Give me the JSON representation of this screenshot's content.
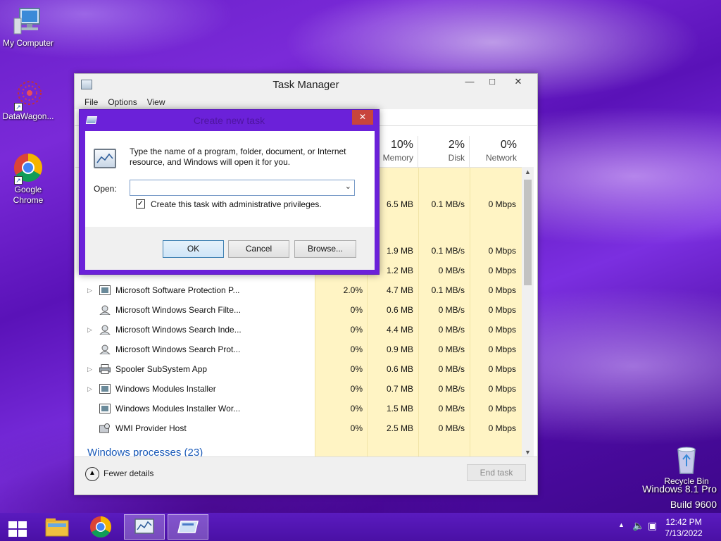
{
  "desktop": {
    "icons": [
      {
        "label": "My Computer",
        "icon": "computer-icon"
      },
      {
        "label": "DataWagon...",
        "icon": "datawagon-icon"
      },
      {
        "label": "Google\nChrome",
        "icon": "chrome-icon"
      },
      {
        "label": "Recycle Bin",
        "icon": "recycle-bin-icon"
      }
    ],
    "watermark": {
      "line1": "Windows 8.1 Pro",
      "line2": "Build 9600"
    }
  },
  "task_manager": {
    "title": "Task Manager",
    "menu": [
      "File",
      "Options",
      "View"
    ],
    "columns": [
      {
        "pct": "10%",
        "name": "Memory"
      },
      {
        "pct": "2%",
        "name": "Disk"
      },
      {
        "pct": "0%",
        "name": "Network"
      }
    ],
    "partial_rows": [
      {
        "memory": "6.5 MB",
        "disk": "0.1 MB/s",
        "network": "0 Mbps"
      },
      {
        "memory": "1.9 MB",
        "disk": "0.1 MB/s",
        "network": "0 Mbps"
      },
      {
        "memory": "1.2 MB",
        "disk": "0 MB/s",
        "network": "0 Mbps"
      }
    ],
    "processes": [
      {
        "name": "Microsoft Software Protection P...",
        "cpu": "2.0%",
        "memory": "4.7 MB",
        "disk": "0.1 MB/s",
        "network": "0 Mbps",
        "expandable": true,
        "icon": "service-icon"
      },
      {
        "name": "Microsoft Windows Search Filte...",
        "cpu": "0%",
        "memory": "0.6 MB",
        "disk": "0 MB/s",
        "network": "0 Mbps",
        "expandable": false,
        "icon": "search-user-icon"
      },
      {
        "name": "Microsoft Windows Search Inde...",
        "cpu": "0%",
        "memory": "4.4 MB",
        "disk": "0 MB/s",
        "network": "0 Mbps",
        "expandable": true,
        "icon": "search-user-icon"
      },
      {
        "name": "Microsoft Windows Search Prot...",
        "cpu": "0%",
        "memory": "0.9 MB",
        "disk": "0 MB/s",
        "network": "0 Mbps",
        "expandable": false,
        "icon": "search-user-icon"
      },
      {
        "name": "Spooler SubSystem App",
        "cpu": "0%",
        "memory": "0.6 MB",
        "disk": "0 MB/s",
        "network": "0 Mbps",
        "expandable": true,
        "icon": "printer-icon"
      },
      {
        "name": "Windows Modules Installer",
        "cpu": "0%",
        "memory": "0.7 MB",
        "disk": "0 MB/s",
        "network": "0 Mbps",
        "expandable": true,
        "icon": "service-icon"
      },
      {
        "name": "Windows Modules Installer Wor...",
        "cpu": "0%",
        "memory": "1.5 MB",
        "disk": "0 MB/s",
        "network": "0 Mbps",
        "expandable": false,
        "icon": "service-icon"
      },
      {
        "name": "WMI Provider Host",
        "cpu": "0%",
        "memory": "2.5 MB",
        "disk": "0 MB/s",
        "network": "0 Mbps",
        "expandable": false,
        "icon": "wmi-icon"
      }
    ],
    "group_heading": "Windows processes (23)",
    "footer": {
      "fewer_details": "Fewer details",
      "end_task": "End task"
    }
  },
  "dialog": {
    "title": "Create new task",
    "description": "Type the name of a program, folder, document, or Internet resource, and Windows will open it for you.",
    "open_label": "Open:",
    "open_value": "",
    "admin_label": "Create this task with administrative privileges.",
    "admin_checked": true,
    "buttons": {
      "ok": "OK",
      "cancel": "Cancel",
      "browse": "Browse..."
    }
  },
  "taskbar": {
    "clock_time": "12:42 PM",
    "clock_date": "7/13/2022"
  },
  "colors": {
    "accent": "#6b21d9",
    "heat": "#fff4c4",
    "link": "#1a5ab8"
  }
}
